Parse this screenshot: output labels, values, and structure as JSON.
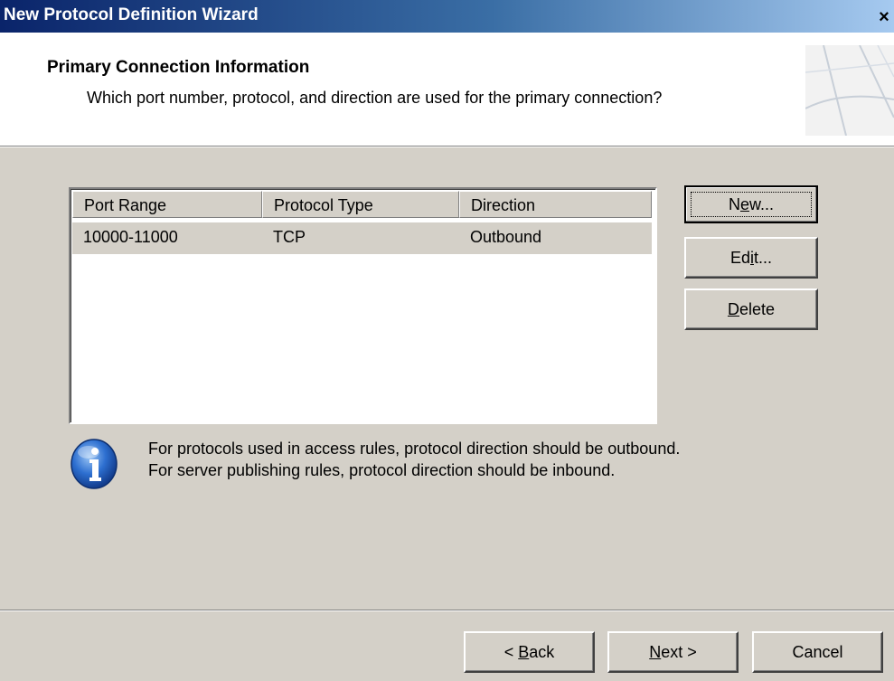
{
  "window": {
    "title": "New Protocol Definition Wizard",
    "close_symbol": "×"
  },
  "header": {
    "title": "Primary Connection Information",
    "subtitle": "Which port number, protocol, and direction are used for the primary connection?",
    "graphic_icon": "wizard-banner-graphic"
  },
  "list": {
    "columns": [
      "Port Range",
      "Protocol Type",
      "Direction"
    ],
    "rows": [
      [
        "10000-11000",
        "TCP",
        "Outbound"
      ]
    ]
  },
  "side_buttons": {
    "new": {
      "pre": "N",
      "mn": "e",
      "post": "w..."
    },
    "edit": {
      "pre": "Ed",
      "mn": "i",
      "post": "t..."
    },
    "delete": {
      "pre": "",
      "mn": "D",
      "post": "elete"
    }
  },
  "info": {
    "icon": "info-icon",
    "line1": "For protocols used in access rules, protocol direction should be outbound.",
    "line2": "For server publishing rules, protocol direction should be inbound."
  },
  "footer": {
    "back": {
      "pre": "< ",
      "mn": "B",
      "post": "ack"
    },
    "next": {
      "pre": "",
      "mn": "N",
      "post": "ext >"
    },
    "cancel": "Cancel"
  },
  "colors": {
    "title_bar_start": "#0a246a",
    "title_bar_end": "#a6caf0",
    "dialog_face": "#d4d0c8",
    "selected_row": "#d4d0c8"
  }
}
